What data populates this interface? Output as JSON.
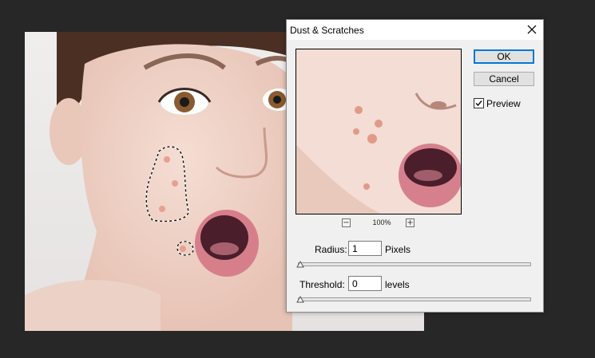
{
  "dialog": {
    "title": "Dust & Scratches",
    "ok_label": "OK",
    "cancel_label": "Cancel",
    "preview_label": "Preview",
    "preview_checked": true,
    "zoom_label": "100%",
    "zoom_minus": "−",
    "zoom_plus": "+",
    "radius": {
      "label": "Radius:",
      "value": "1",
      "unit": "Pixels",
      "slider_position": 0.0
    },
    "threshold": {
      "label": "Threshold:",
      "value": "0",
      "unit": "levels",
      "slider_position": 0.0
    }
  },
  "icons": {
    "close": "close-icon",
    "checkmark": "checkmark-icon"
  },
  "colors": {
    "workspace_bg": "#272727",
    "dialog_bg": "#f0f0f0",
    "accent": "#0078d7"
  }
}
